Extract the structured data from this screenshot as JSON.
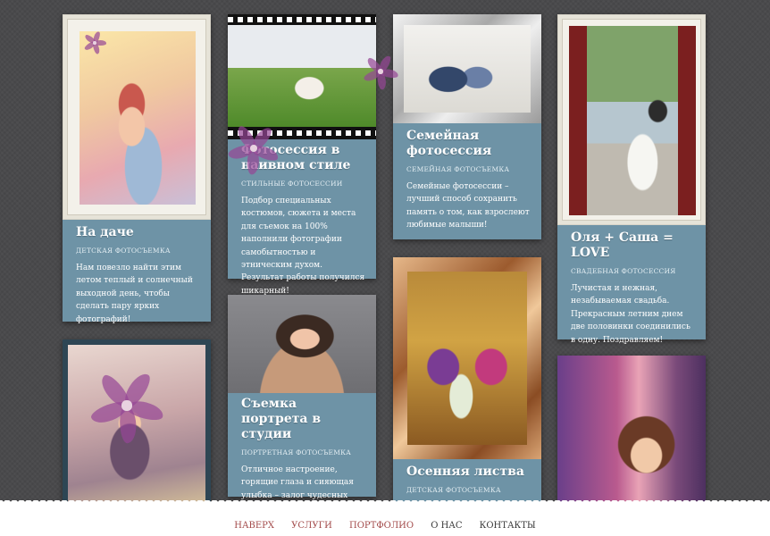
{
  "colors": {
    "background": "#4a4a4c",
    "card": "#6e93a6",
    "nav_link": "#a34b4b",
    "nav_link_dark": "#3a3a3a"
  },
  "cards": [
    {
      "title": "На даче",
      "category": "ДЕТСКАЯ ФОТОСЪЕМКА",
      "text": "Нам повезло найти этим летом теплый и солнечный выходной день, чтобы сделать пару ярких фотографий!",
      "frame": "white-frame"
    },
    {
      "title": "Фотосессия в наивном стиле",
      "category": "СТИЛЬНЫЕ ФОТОСЕССИИ",
      "text": "Подбор специальных костюмов, сюжета и места для съемок на 100% наполнили фотографии самобытностью и этническим духом. Результат работы получился шикарный!",
      "frame": "film-strip"
    },
    {
      "title": "Семейная фотосессия",
      "category": "СЕМЕЙНАЯ ФОТОСЪЕМКА",
      "text": "Семейные фотосессии – лучший способ сохранить память о том, как взрослеют любимые малыши!",
      "frame": "silver-frame"
    },
    {
      "title": "Оля + Саша = LOVE",
      "category": "СВАДЕБНАЯ ФОТОСЕССИЯ",
      "text": "Лучистая и нежная, незабываемая свадьба. Прекрасным летним днем две половинки соединились в одну. Поздравляем!",
      "frame": "white-frame"
    },
    {
      "title": "Съемка портрета в студии",
      "category": "ПОРТРЕТНАЯ ФОТОСЪЕМКА",
      "text": "Отличное настроение, горящие глаза и сияющая улыбка – залог чудесных кадров!",
      "frame": "none"
    },
    {
      "title": "Осенняя листва",
      "category": "ДЕТСКАЯ ФОТОСЪЕМКА",
      "text": "",
      "frame": "gold-frame"
    }
  ],
  "extra_photos": [
    {
      "description_icon": "child-with-flower-photo"
    },
    {
      "description_icon": "girl-with-crown-photo"
    }
  ],
  "footer": {
    "links": [
      "НАВЕРХ",
      "УСЛУГИ",
      "ПОРТФОЛИО",
      "О НАС",
      "КОНТАКТЫ"
    ]
  }
}
